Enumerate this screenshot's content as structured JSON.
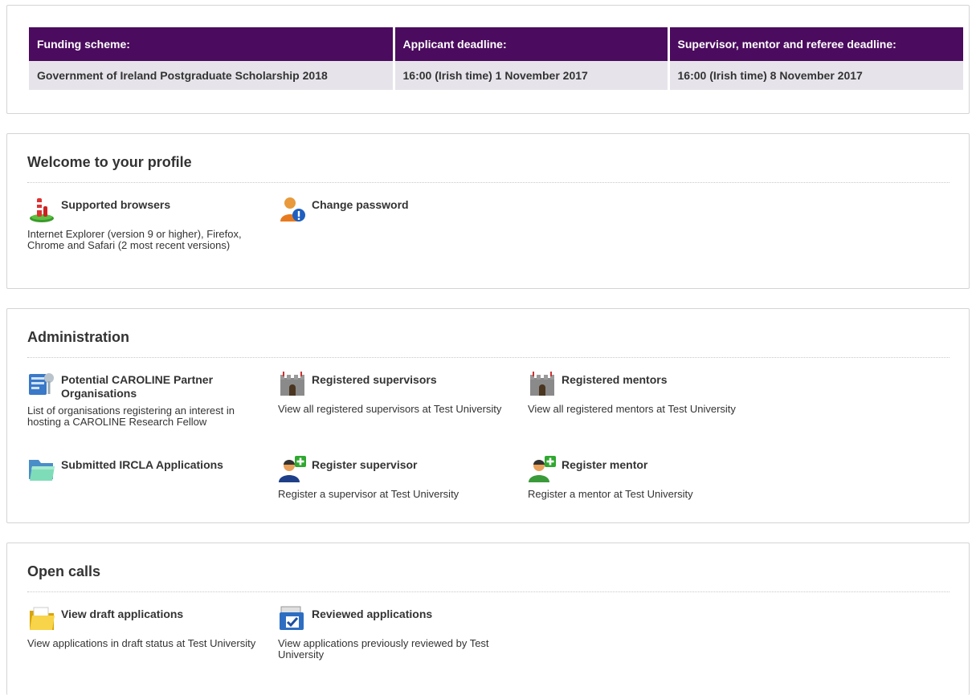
{
  "deadlines": {
    "headers": [
      "Funding scheme:",
      "Applicant deadline:",
      "Supervisor, mentor and referee deadline:"
    ],
    "row": [
      "Government of Ireland Postgraduate Scholarship 2018",
      "16:00 (Irish time) 1 November 2017",
      "16:00 (Irish time) 8 November 2017"
    ]
  },
  "welcome": {
    "title": "Welcome to your profile",
    "items": [
      {
        "label": "Supported browsers",
        "icon": "browser-icon",
        "desc": "Internet Explorer (version 9 or higher), Firefox, Chrome and Safari (2 most recent versions)"
      },
      {
        "label": "Change password",
        "icon": "user-info-icon",
        "desc": ""
      }
    ]
  },
  "administration": {
    "title": "Administration",
    "items": [
      {
        "label": "Potential CAROLINE Partner Organisations",
        "icon": "organisation-key-icon",
        "desc": "List of organisations registering an interest in hosting a CAROLINE Research Fellow"
      },
      {
        "label": "Registered supervisors",
        "icon": "castle-icon",
        "desc": "View all registered supervisors at Test University"
      },
      {
        "label": "Registered mentors",
        "icon": "castle-icon",
        "desc": "View all registered mentors at Test University"
      },
      {
        "label": "Submitted IRCLA Applications",
        "icon": "folder-icon",
        "desc": ""
      },
      {
        "label": "Register supervisor",
        "icon": "add-user-icon",
        "desc": "Register a supervisor at Test University"
      },
      {
        "label": "Register mentor",
        "icon": "add-user-icon",
        "desc": "Register a mentor at Test University"
      }
    ]
  },
  "open_calls": {
    "title": "Open calls",
    "items": [
      {
        "label": "View draft applications",
        "icon": "draft-folder-icon",
        "desc": "View applications in draft status at Test University"
      },
      {
        "label": "Reviewed applications",
        "icon": "reviewed-checkbox-icon",
        "desc": "View applications previously reviewed by Test University"
      }
    ]
  },
  "colors": {
    "header_bg": "#4b0b5e",
    "row_bg": "#e6e4ea",
    "text": "#333333"
  }
}
